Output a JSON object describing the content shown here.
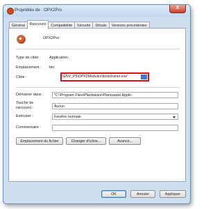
{
  "window": {
    "title": "Propriétés de : OPX2Pro",
    "close_label": "X"
  },
  "tabs": [
    {
      "label": "Général",
      "active": false
    },
    {
      "label": "Raccourci",
      "active": true
    },
    {
      "label": "Compatibilité",
      "active": false
    },
    {
      "label": "Sécurité",
      "active": false
    },
    {
      "label": "Détails",
      "active": false
    },
    {
      "label": "Versions précédentes",
      "active": false
    }
  ],
  "shortcut": {
    "app_name": "OPX2Pro",
    "type_label": "Type de cible :",
    "type_value": "Application",
    "location_label": "Emplacement :",
    "location_value": "bin",
    "target_label": "Cible :",
    "target_value": "\\ENV_P5\\OPX2Modules\\bin\\intranet.exe\" ",
    "start_label": "Démarrer dans :",
    "start_value": "\"C:\\Program Files\\Planisware\\Planisware Applic",
    "hotkey_label_line1": "Touche de",
    "hotkey_label_line2": "raccourci :",
    "hotkey_value": "Aucun",
    "run_label": "Exécuter :",
    "run_value": "Fenêtre normale",
    "comment_label": "Commentaire :",
    "comment_value": ""
  },
  "action_buttons": {
    "open_location": "Emplacement du fichier",
    "change_icon": "Changer d'icône...",
    "advanced": "Avancé..."
  },
  "footer_buttons": {
    "ok": "OK",
    "cancel": "Annuler",
    "apply": "Appliquer"
  },
  "colors": {
    "highlight_border": "#d3131c",
    "dialog_frame": "#cddff1"
  }
}
